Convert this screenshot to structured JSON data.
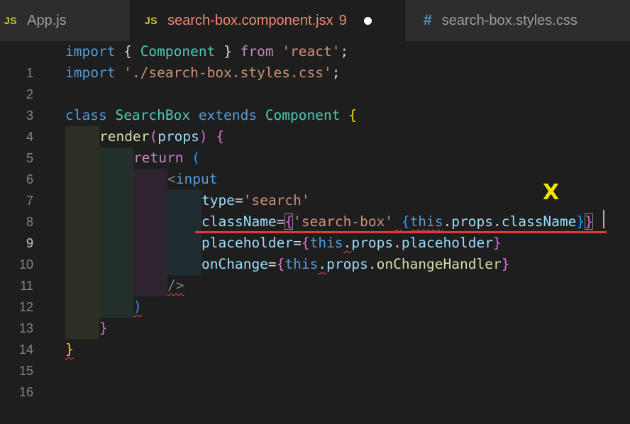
{
  "tabs": [
    {
      "icon": "JS",
      "label": "App.js"
    },
    {
      "icon": "JS",
      "label": "search-box.component.jsx",
      "problems": "9"
    },
    {
      "icon": "#",
      "label": "search-box.styles.css"
    }
  ],
  "annotation": {
    "mark": "X"
  },
  "lines": {
    "l1": {
      "n": "1",
      "t": [
        "import",
        " { ",
        "Component",
        " } ",
        "from",
        " ",
        "'react'",
        ";"
      ]
    },
    "l2": {
      "n": "2",
      "t": [
        "import",
        " ",
        "'./search-box.styles.css'",
        ";"
      ]
    },
    "l3": {
      "n": "3"
    },
    "l4": {
      "n": "4",
      "t": [
        "class",
        " ",
        "SearchBox",
        " ",
        "extends",
        " ",
        "Component",
        " ",
        "{"
      ]
    },
    "l5": {
      "n": "5",
      "t": [
        "render",
        "(",
        "props",
        ")",
        " ",
        "{"
      ]
    },
    "l6": {
      "n": "6",
      "t": [
        "return",
        " ",
        "("
      ]
    },
    "l7": {
      "n": "7",
      "t": [
        "<",
        "input"
      ]
    },
    "l8": {
      "n": "8",
      "t": [
        "type",
        "=",
        "'search'"
      ]
    },
    "l9": {
      "n": "9",
      "t": [
        "className",
        "=",
        "{",
        "'search-box'",
        " ",
        "{",
        "this",
        ".",
        "props",
        ".",
        "className",
        "}",
        "}"
      ]
    },
    "l10": {
      "n": "10",
      "t": [
        "placeholder",
        "=",
        "{",
        "this",
        ".",
        "props",
        ".",
        "placeholder",
        "}"
      ]
    },
    "l11": {
      "n": "11",
      "t": [
        "onChange",
        "=",
        "{",
        "this",
        ".",
        "props",
        ".",
        "onChangeHandler",
        "}"
      ]
    },
    "l12": {
      "n": "12",
      "t": [
        "/>"
      ]
    },
    "l13": {
      "n": "13",
      "t": [
        ")"
      ]
    },
    "l14": {
      "n": "14",
      "t": [
        "}"
      ]
    },
    "l15": {
      "n": "15",
      "t": [
        "}"
      ]
    },
    "l16": {
      "n": "16"
    }
  },
  "colors": {
    "keyword": "#569cd6",
    "control": "#c586c0",
    "class": "#4ec9b0",
    "string": "#ce9178",
    "attribute": "#9cdcfe",
    "function": "#dcdcaa",
    "error": "#f14c4c",
    "annotation_mark": "#f5e600",
    "annotation_line": "#e53935"
  }
}
